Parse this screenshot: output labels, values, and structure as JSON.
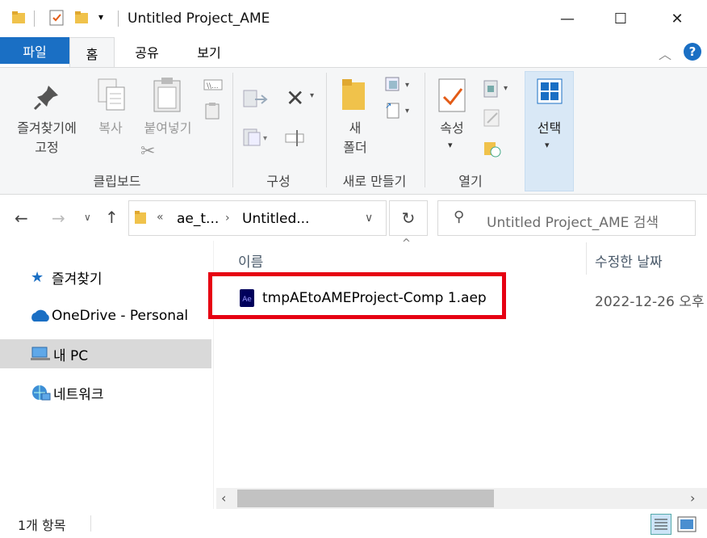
{
  "window": {
    "title": "Untitled Project_AME",
    "minimize_glyph": "—",
    "maximize_glyph": "☐",
    "close_glyph": "✕"
  },
  "ribbon_tabs": {
    "file": "파일",
    "home": "홈",
    "share": "공유",
    "view": "보기"
  },
  "ribbon": {
    "pin_label_1": "즐겨찾기에",
    "pin_label_2": "고정",
    "copy": "복사",
    "paste": "붙여넣기",
    "clipboard_group": "클립보드",
    "organize_group": "구성",
    "new_folder_1": "새",
    "new_folder_2": "폴더",
    "new_group": "새로 만들기",
    "properties": "속성",
    "open_group": "열기",
    "select": "선택"
  },
  "address": {
    "overflow": "«",
    "crumb_1": "ae_t...",
    "crumb_2": "Untitled...",
    "search_placeholder": "Untitled Project_AME 검색"
  },
  "nav": {
    "items": [
      {
        "label": "즐겨찾기",
        "icon": "star-icon"
      },
      {
        "label": "OneDrive - Personal",
        "icon": "cloud-icon"
      },
      {
        "label": "내 PC",
        "icon": "computer-icon"
      },
      {
        "label": "네트워크",
        "icon": "network-icon"
      }
    ]
  },
  "file_list": {
    "columns": {
      "name": "이름",
      "date": "수정한 날짜"
    },
    "rows": [
      {
        "name": "tmpAEtoAMEProject-Comp 1.aep",
        "date": "2022-12-26 오후",
        "icon": "after-effects-file-icon",
        "icon_text": "Ae"
      }
    ]
  },
  "status": {
    "count": "1개 항목"
  },
  "colors": {
    "accent": "#1a6fc4",
    "highlight": "#e60012",
    "ae_icon": "#00005b"
  }
}
